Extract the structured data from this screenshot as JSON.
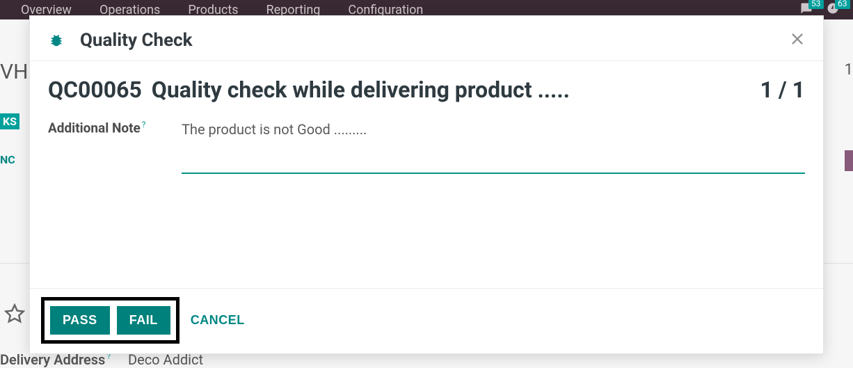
{
  "background": {
    "nav": [
      "Overview",
      "Operations",
      "Products",
      "Reporting",
      "Configuration"
    ],
    "badges": [
      "53",
      "63"
    ],
    "wh": "VH",
    "ks": "KS",
    "nc": "NC",
    "one": "1",
    "delivery_label": "Delivery Address",
    "delivery_value": "Deco Addict"
  },
  "modal": {
    "title": "Quality Check",
    "ref": "QC00065",
    "description": "Quality check while delivering product .....",
    "counter": "1 / 1",
    "note_label": "Additional Note",
    "note_value": "The product is not Good .........",
    "buttons": {
      "pass": "PASS",
      "fail": "FAIL",
      "cancel": "CANCEL"
    }
  }
}
